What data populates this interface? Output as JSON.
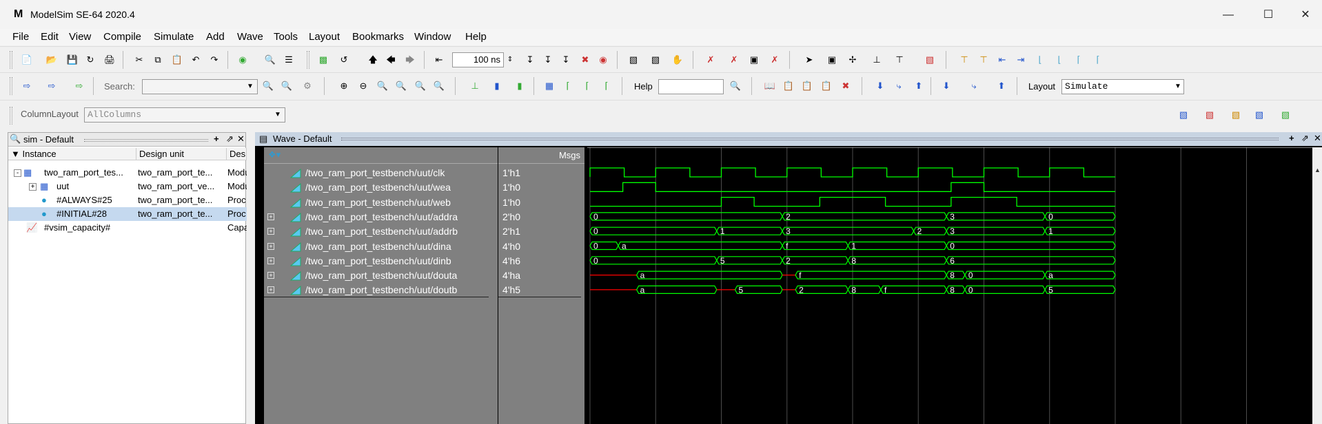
{
  "window": {
    "title": "ModelSim SE-64 2020.4",
    "app_icon": "M"
  },
  "menu": [
    "File",
    "Edit",
    "View",
    "Compile",
    "Simulate",
    "Add",
    "Wave",
    "Tools",
    "Layout",
    "Bookmarks",
    "Window",
    "Help"
  ],
  "toolbar": {
    "time_value": "100",
    "time_unit": "ns",
    "search_label": "Search:",
    "search_value": "",
    "help_label": "Help",
    "help_value": "",
    "layout_label": "Layout",
    "layout_value": "Simulate",
    "column_layout_label": "ColumnLayout",
    "column_layout_value": "AllColumns"
  },
  "sim_panel": {
    "title": "sim - Default",
    "columns": [
      "Instance",
      "Design unit",
      "Design"
    ],
    "rows": [
      {
        "instance": "two_ram_port_tes...",
        "unit": "two_ram_port_te...",
        "type": "Modu"
      },
      {
        "instance": "uut",
        "unit": "two_ram_port_ve...",
        "type": "Modu"
      },
      {
        "instance": "#ALWAYS#25",
        "unit": "two_ram_port_te...",
        "type": "Proc"
      },
      {
        "instance": "#INITIAL#28",
        "unit": "two_ram_port_te...",
        "type": "Proc"
      },
      {
        "instance": "#vsim_capacity#",
        "unit": "",
        "type": "Capa"
      }
    ]
  },
  "wave_panel": {
    "title": "Wave - Default",
    "msgs_label": "Msgs",
    "signals": [
      {
        "name": "/two_ram_port_testbench/uut/clk",
        "value": "1'h1",
        "expandable": false
      },
      {
        "name": "/two_ram_port_testbench/uut/wea",
        "value": "1'h0",
        "expandable": false
      },
      {
        "name": "/two_ram_port_testbench/uut/web",
        "value": "1'h0",
        "expandable": false
      },
      {
        "name": "/two_ram_port_testbench/uut/addra",
        "value": "2'h0",
        "expandable": true
      },
      {
        "name": "/two_ram_port_testbench/uut/addrb",
        "value": "2'h1",
        "expandable": true
      },
      {
        "name": "/two_ram_port_testbench/uut/dina",
        "value": "4'h0",
        "expandable": true
      },
      {
        "name": "/two_ram_port_testbench/uut/dinb",
        "value": "4'h6",
        "expandable": true
      },
      {
        "name": "/two_ram_port_testbench/uut/douta",
        "value": "4'ha",
        "expandable": true
      },
      {
        "name": "/two_ram_port_testbench/uut/doutb",
        "value": "4'h5",
        "expandable": true
      }
    ],
    "bus_labels": {
      "addra": [
        "0",
        "2",
        "3",
        "0"
      ],
      "addrb": [
        "0",
        "1",
        "3",
        "2",
        "3",
        "1"
      ],
      "dina": [
        "0",
        "a",
        "f",
        "1",
        "0"
      ],
      "dinb": [
        "0",
        "5",
        "2",
        "8",
        "6"
      ],
      "douta": [
        "a",
        "f",
        "8",
        "0",
        "a"
      ],
      "doutb": [
        "a",
        "5",
        "2",
        "8",
        "f",
        "8",
        "0",
        "5"
      ]
    },
    "colors": {
      "signal": "#00ff00",
      "undefined": "#ff0000",
      "background": "#000000",
      "grid": "#4d4d4d"
    }
  }
}
